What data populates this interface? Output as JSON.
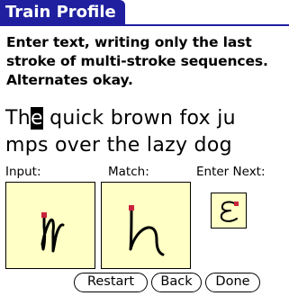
{
  "header": {
    "title": "Train Profile"
  },
  "instructions": "Enter text, writing only the last stroke of multi-stroke sequences. Alternates okay.",
  "sample_text": {
    "before_cursor": "Th",
    "cursor_char": "e",
    "after_cursor": " quick brown fox ju\nmps over the lazy dog"
  },
  "labels": {
    "input": "Input:",
    "match": "Match:",
    "enter_next": "Enter Next:"
  },
  "pads": {
    "input_stroke": "handwritten-n-stroke",
    "match_stroke": "reference-n-stroke",
    "next_glyph": "epsilon-e-glyph"
  },
  "buttons": {
    "restart": "Restart",
    "back": "Back",
    "done": "Done"
  },
  "colors": {
    "title_bg": "#1f1fa0",
    "pad_bg": "#ffffc6",
    "stroke_start": "#c8233c"
  }
}
